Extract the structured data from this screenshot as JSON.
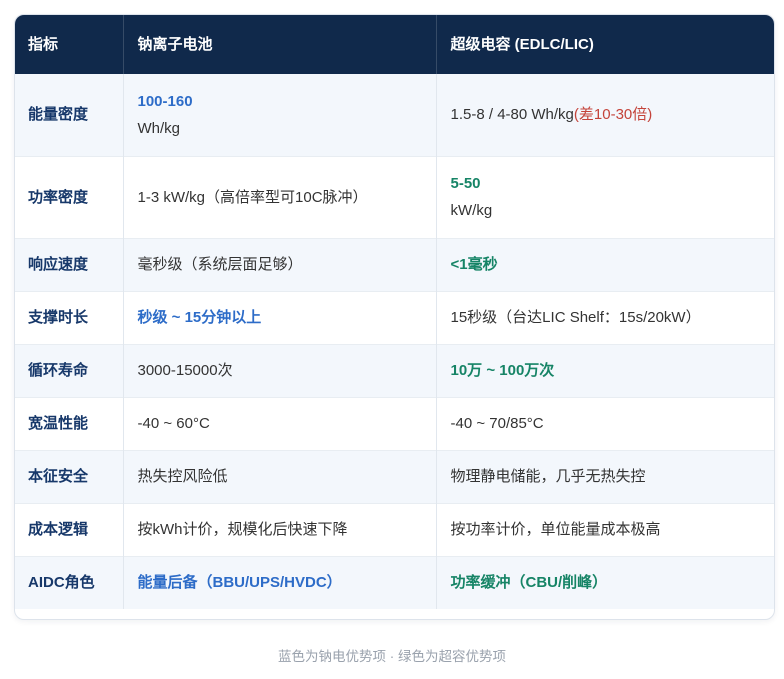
{
  "colors": {
    "header_bg": "#10294b",
    "header_text": "#ffffff",
    "label_text": "#17386a",
    "sodium_highlight": "#2d6cc8",
    "supercap_highlight": "#168466",
    "gap_note": "#c4433a",
    "row_stripe": "#f3f7fc",
    "body_text": "#333333",
    "footer_text": "#9aa2ad"
  },
  "table": {
    "headers": [
      "指标",
      "钠离子电池",
      "超级电容 (EDLC/LIC)"
    ],
    "rows": [
      {
        "label": "能量密度",
        "sodium": {
          "value": "100-160",
          "unit": "Wh/kg"
        },
        "supercap": {
          "text": "1.5-8 / 4-80 Wh/kg",
          "note": "(差10-30倍)"
        }
      },
      {
        "label": "功率密度",
        "sodium": {
          "text": "1-3 kW/kg（高倍率型可10C脉冲）"
        },
        "supercap": {
          "value": "5-50",
          "unit": "kW/kg"
        }
      },
      {
        "label": "响应速度",
        "sodium": {
          "text": "毫秒级（系统层面足够）"
        },
        "supercap": {
          "text": "<1毫秒"
        }
      },
      {
        "label": "支撑时长",
        "sodium": {
          "text": "秒级 ~ 15分钟以上"
        },
        "supercap": {
          "text": "15秒级（台达LIC Shelf：15s/20kW）"
        }
      },
      {
        "label": "循环寿命",
        "sodium": {
          "text": "3000-15000次"
        },
        "supercap": {
          "text": "10万 ~ 100万次"
        }
      },
      {
        "label": "宽温性能",
        "sodium": {
          "text": "-40 ~ 60°C"
        },
        "supercap": {
          "text": "-40 ~ 70/85°C"
        }
      },
      {
        "label": "本征安全",
        "sodium": {
          "text": "热失控风险低"
        },
        "supercap": {
          "text": "物理静电储能，几乎无热失控"
        }
      },
      {
        "label": "成本逻辑",
        "sodium": {
          "text": "按kWh计价，规模化后快速下降"
        },
        "supercap": {
          "text": "按功率计价，单位能量成本极高"
        }
      },
      {
        "label": "AIDC角色",
        "sodium": {
          "text": "能量后备（BBU/UPS/HVDC）"
        },
        "supercap": {
          "text": "功率缓冲（CBU/削峰）"
        }
      }
    ]
  },
  "footer": {
    "note": "蓝色为钠电优势项 · 绿色为超容优势项"
  }
}
